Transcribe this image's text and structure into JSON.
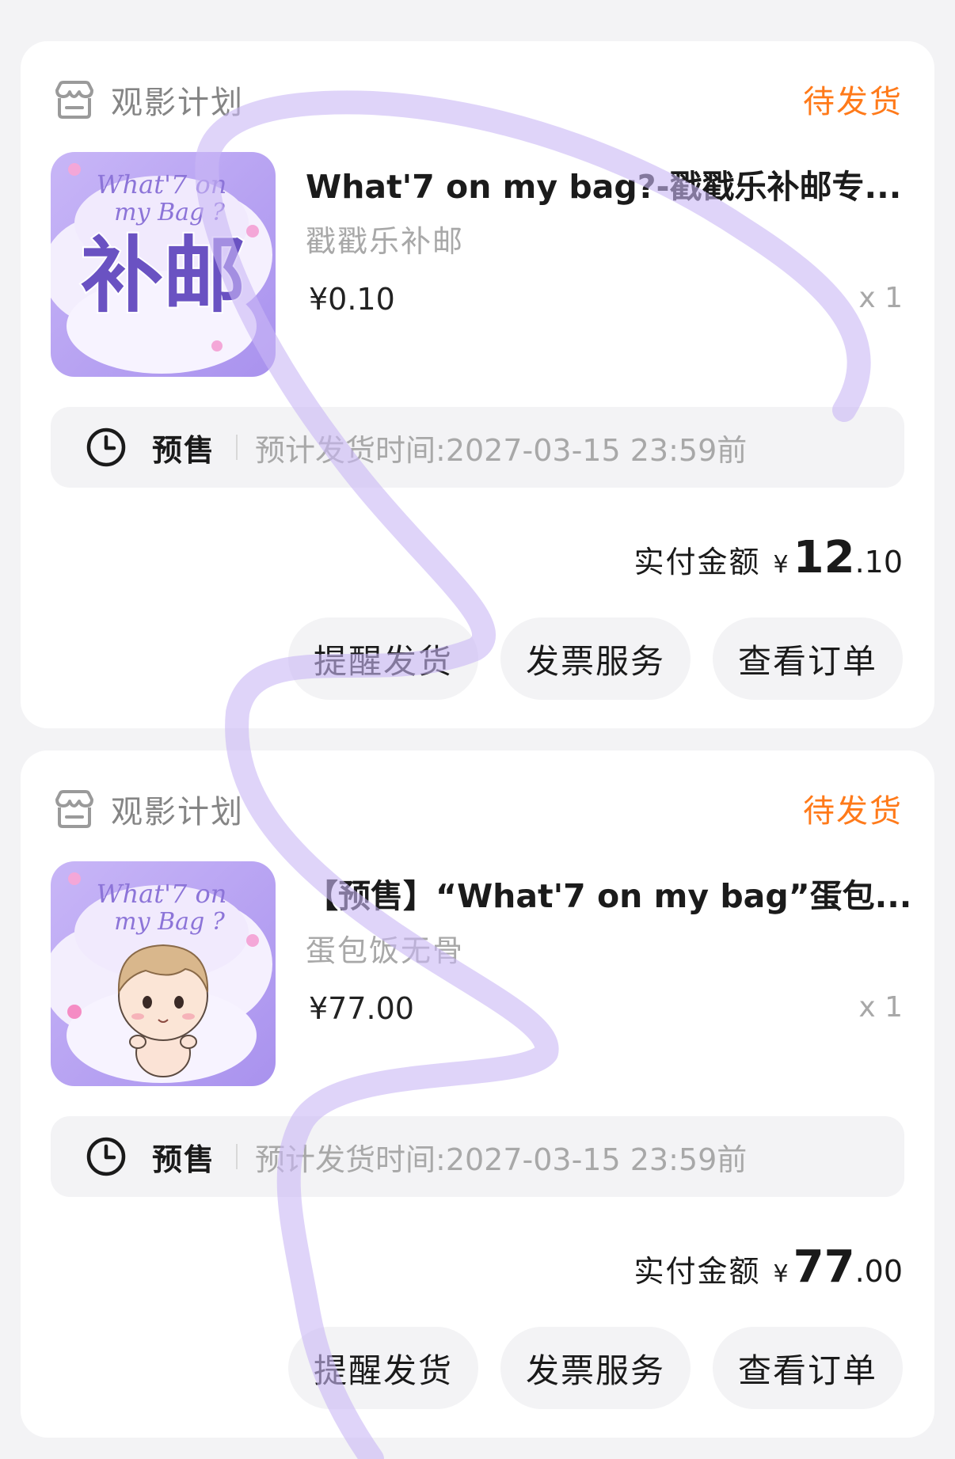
{
  "orders": [
    {
      "shop_name": "观影计划",
      "status": "待发货",
      "product_title": "What'7 on my bag?-戳戳乐补邮专...",
      "product_sub": "戳戳乐补邮",
      "price": "¥0.10",
      "quantity": "x 1",
      "thumb_text": "补邮",
      "presale_tag": "预售",
      "presale_time": "预计发货时间:2027-03-15 23:59前",
      "total_label": "实付金额",
      "total_yen": "¥",
      "total_int": "12",
      "total_dec": ".10",
      "buttons": [
        "提醒发货",
        "发票服务",
        "查看订单"
      ]
    },
    {
      "shop_name": "观影计划",
      "status": "待发货",
      "product_title": "【预售】“What'7 on my bag”蛋包...",
      "product_sub": "蛋包饭无骨",
      "price": "¥77.00",
      "quantity": "x 1",
      "presale_tag": "预售",
      "presale_time": "预计发货时间:2027-03-15 23:59前",
      "total_label": "实付金额",
      "total_yen": "¥",
      "total_int": "77",
      "total_dec": ".00",
      "buttons": [
        "提醒发货",
        "发票服务",
        "查看订单"
      ]
    }
  ],
  "thumb_logo": {
    "line1": "What'7 on",
    "line2": "my Bag ?"
  },
  "colors": {
    "status": "#ff7a1a",
    "background": "#f3f3f5",
    "scribble": "#c9b8f5",
    "thumb_purple": "#b9a4f0"
  },
  "icons": {
    "shop": "shop-icon",
    "clock": "clock-icon"
  }
}
